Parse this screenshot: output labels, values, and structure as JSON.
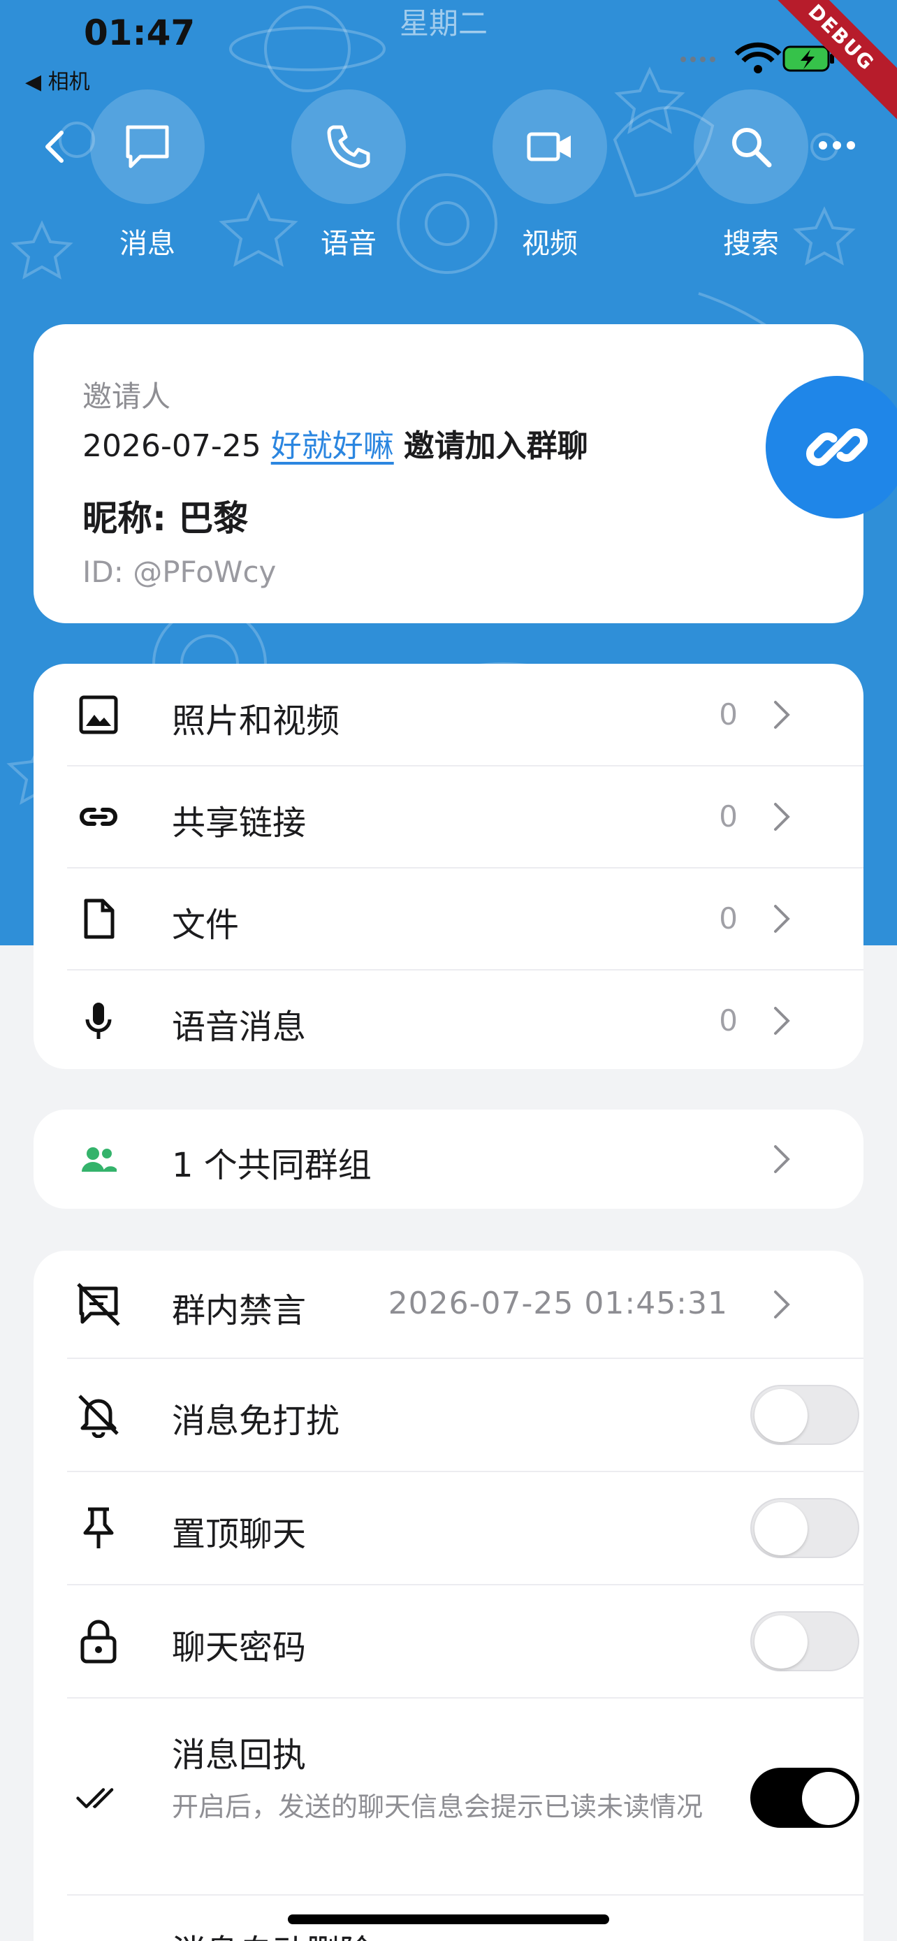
{
  "status_bar": {
    "time": "01:47",
    "back_app": "◀ 相机",
    "weekday": "星期二",
    "debug_label": "DEBUG"
  },
  "colors": {
    "hero_blue": "#2f8fd8",
    "link_blue": "#2b86e0",
    "fab_blue": "#1f86e8",
    "group_icon_green": "#34b36b"
  },
  "actions": [
    {
      "label": "消息",
      "icon": "message-icon"
    },
    {
      "label": "语音",
      "icon": "phone-icon"
    },
    {
      "label": "视频",
      "icon": "video-icon"
    },
    {
      "label": "搜索",
      "icon": "search-icon"
    }
  ],
  "profile": {
    "inviter_label": "邀请人",
    "invite_date": "2026-07-25",
    "inviter_name": "好就好嘛",
    "invite_action": "邀请加入群聊",
    "nickname": "昵称: 巴黎",
    "user_id": "ID: @PFoWcy"
  },
  "media": [
    {
      "label": "照片和视频",
      "count": "0",
      "icon": "photo-icon"
    },
    {
      "label": "共享链接",
      "count": "0",
      "icon": "link-icon"
    },
    {
      "label": "文件",
      "count": "0",
      "icon": "file-icon"
    },
    {
      "label": "语音消息",
      "count": "0",
      "icon": "mic-icon"
    }
  ],
  "common_groups": {
    "label": "1 个共同群组",
    "icon": "group-icon"
  },
  "settings": {
    "mute": {
      "label": "群内禁言",
      "value": "2026-07-25 01:45:31"
    },
    "dnd": {
      "label": "消息免打扰",
      "on": false
    },
    "pin": {
      "label": "置顶聊天",
      "on": false
    },
    "password": {
      "label": "聊天密码",
      "on": false
    },
    "receipt": {
      "label": "消息回执",
      "desc": "开启后，发送的聊天信息会提示已读未读情况",
      "on": true
    },
    "auto_delete": {
      "label": "消息自动删除"
    }
  }
}
